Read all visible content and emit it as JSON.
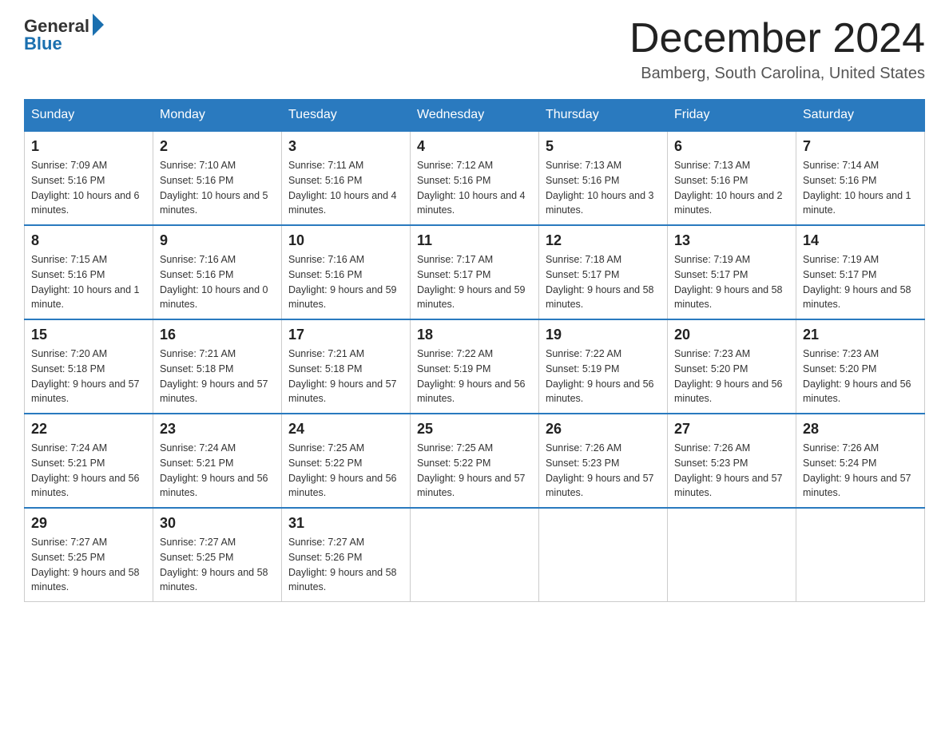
{
  "logo": {
    "general": "General",
    "blue": "Blue"
  },
  "title": "December 2024",
  "location": "Bamberg, South Carolina, United States",
  "days_of_week": [
    "Sunday",
    "Monday",
    "Tuesday",
    "Wednesday",
    "Thursday",
    "Friday",
    "Saturday"
  ],
  "weeks": [
    [
      {
        "day": "1",
        "sunrise": "7:09 AM",
        "sunset": "5:16 PM",
        "daylight": "10 hours and 6 minutes."
      },
      {
        "day": "2",
        "sunrise": "7:10 AM",
        "sunset": "5:16 PM",
        "daylight": "10 hours and 5 minutes."
      },
      {
        "day": "3",
        "sunrise": "7:11 AM",
        "sunset": "5:16 PM",
        "daylight": "10 hours and 4 minutes."
      },
      {
        "day": "4",
        "sunrise": "7:12 AM",
        "sunset": "5:16 PM",
        "daylight": "10 hours and 4 minutes."
      },
      {
        "day": "5",
        "sunrise": "7:13 AM",
        "sunset": "5:16 PM",
        "daylight": "10 hours and 3 minutes."
      },
      {
        "day": "6",
        "sunrise": "7:13 AM",
        "sunset": "5:16 PM",
        "daylight": "10 hours and 2 minutes."
      },
      {
        "day": "7",
        "sunrise": "7:14 AM",
        "sunset": "5:16 PM",
        "daylight": "10 hours and 1 minute."
      }
    ],
    [
      {
        "day": "8",
        "sunrise": "7:15 AM",
        "sunset": "5:16 PM",
        "daylight": "10 hours and 1 minute."
      },
      {
        "day": "9",
        "sunrise": "7:16 AM",
        "sunset": "5:16 PM",
        "daylight": "10 hours and 0 minutes."
      },
      {
        "day": "10",
        "sunrise": "7:16 AM",
        "sunset": "5:16 PM",
        "daylight": "9 hours and 59 minutes."
      },
      {
        "day": "11",
        "sunrise": "7:17 AM",
        "sunset": "5:17 PM",
        "daylight": "9 hours and 59 minutes."
      },
      {
        "day": "12",
        "sunrise": "7:18 AM",
        "sunset": "5:17 PM",
        "daylight": "9 hours and 58 minutes."
      },
      {
        "day": "13",
        "sunrise": "7:19 AM",
        "sunset": "5:17 PM",
        "daylight": "9 hours and 58 minutes."
      },
      {
        "day": "14",
        "sunrise": "7:19 AM",
        "sunset": "5:17 PM",
        "daylight": "9 hours and 58 minutes."
      }
    ],
    [
      {
        "day": "15",
        "sunrise": "7:20 AM",
        "sunset": "5:18 PM",
        "daylight": "9 hours and 57 minutes."
      },
      {
        "day": "16",
        "sunrise": "7:21 AM",
        "sunset": "5:18 PM",
        "daylight": "9 hours and 57 minutes."
      },
      {
        "day": "17",
        "sunrise": "7:21 AM",
        "sunset": "5:18 PM",
        "daylight": "9 hours and 57 minutes."
      },
      {
        "day": "18",
        "sunrise": "7:22 AM",
        "sunset": "5:19 PM",
        "daylight": "9 hours and 56 minutes."
      },
      {
        "day": "19",
        "sunrise": "7:22 AM",
        "sunset": "5:19 PM",
        "daylight": "9 hours and 56 minutes."
      },
      {
        "day": "20",
        "sunrise": "7:23 AM",
        "sunset": "5:20 PM",
        "daylight": "9 hours and 56 minutes."
      },
      {
        "day": "21",
        "sunrise": "7:23 AM",
        "sunset": "5:20 PM",
        "daylight": "9 hours and 56 minutes."
      }
    ],
    [
      {
        "day": "22",
        "sunrise": "7:24 AM",
        "sunset": "5:21 PM",
        "daylight": "9 hours and 56 minutes."
      },
      {
        "day": "23",
        "sunrise": "7:24 AM",
        "sunset": "5:21 PM",
        "daylight": "9 hours and 56 minutes."
      },
      {
        "day": "24",
        "sunrise": "7:25 AM",
        "sunset": "5:22 PM",
        "daylight": "9 hours and 56 minutes."
      },
      {
        "day": "25",
        "sunrise": "7:25 AM",
        "sunset": "5:22 PM",
        "daylight": "9 hours and 57 minutes."
      },
      {
        "day": "26",
        "sunrise": "7:26 AM",
        "sunset": "5:23 PM",
        "daylight": "9 hours and 57 minutes."
      },
      {
        "day": "27",
        "sunrise": "7:26 AM",
        "sunset": "5:23 PM",
        "daylight": "9 hours and 57 minutes."
      },
      {
        "day": "28",
        "sunrise": "7:26 AM",
        "sunset": "5:24 PM",
        "daylight": "9 hours and 57 minutes."
      }
    ],
    [
      {
        "day": "29",
        "sunrise": "7:27 AM",
        "sunset": "5:25 PM",
        "daylight": "9 hours and 58 minutes."
      },
      {
        "day": "30",
        "sunrise": "7:27 AM",
        "sunset": "5:25 PM",
        "daylight": "9 hours and 58 minutes."
      },
      {
        "day": "31",
        "sunrise": "7:27 AM",
        "sunset": "5:26 PM",
        "daylight": "9 hours and 58 minutes."
      },
      null,
      null,
      null,
      null
    ]
  ],
  "labels": {
    "sunrise": "Sunrise:",
    "sunset": "Sunset:",
    "daylight": "Daylight:"
  },
  "colors": {
    "header_bg": "#2a7abf",
    "header_text": "#ffffff",
    "border_top": "#2a7abf"
  }
}
